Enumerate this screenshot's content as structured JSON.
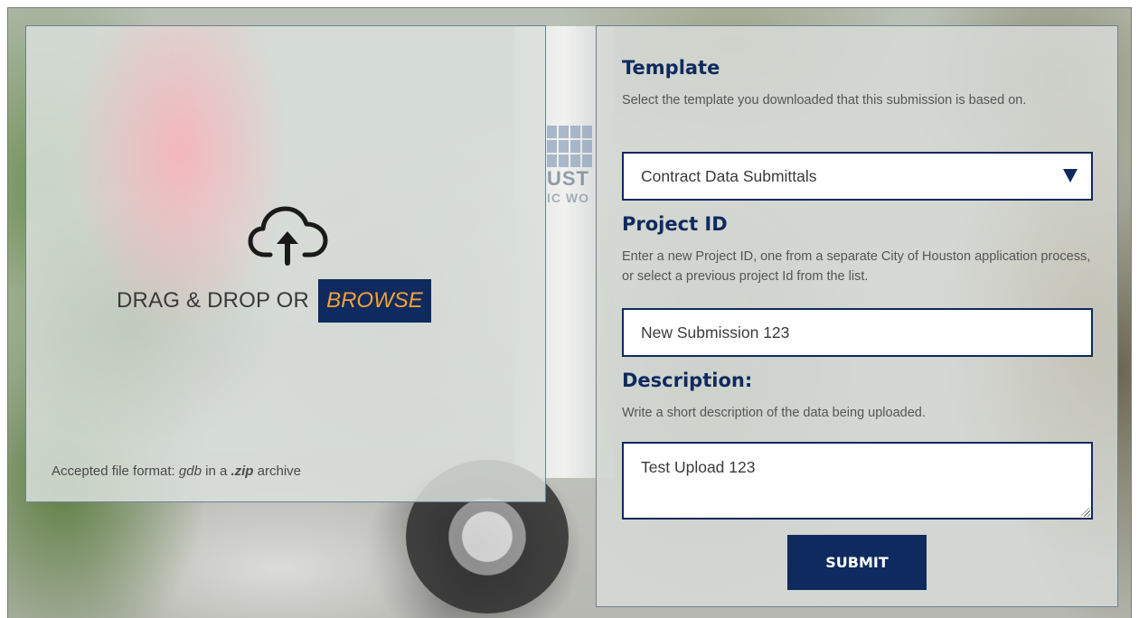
{
  "dropzone": {
    "icon": "cloud-upload-icon",
    "prompt": "DRAG & DROP OR",
    "browse_label": "BROWSE",
    "accepted_prefix": "Accepted file format:",
    "accepted_format": "gdb",
    "accepted_middle": "in a",
    "accepted_archive": ".zip",
    "accepted_suffix": "archive"
  },
  "form": {
    "template": {
      "heading": "Template",
      "helper": "Select the template you downloaded that this submission is based on.",
      "selected": "Contract Data Submittals",
      "arrow_icon": "triangle-down-icon"
    },
    "project_id": {
      "heading": "Project ID",
      "helper": "Enter a new Project ID, one from a separate City of Houston application process, or select a previous project Id from the list.",
      "value": "New Submission 123"
    },
    "description": {
      "heading": "Description:",
      "helper": "Write a short description of the data being uploaded.",
      "value": "Test Upload 123"
    },
    "submit_label": "SUBMIT"
  },
  "background_logo": {
    "line1": "UST",
    "line2": "IC WO"
  },
  "colors": {
    "brand_navy": "#0f2a5e",
    "browse_accent": "#f2a23a"
  }
}
